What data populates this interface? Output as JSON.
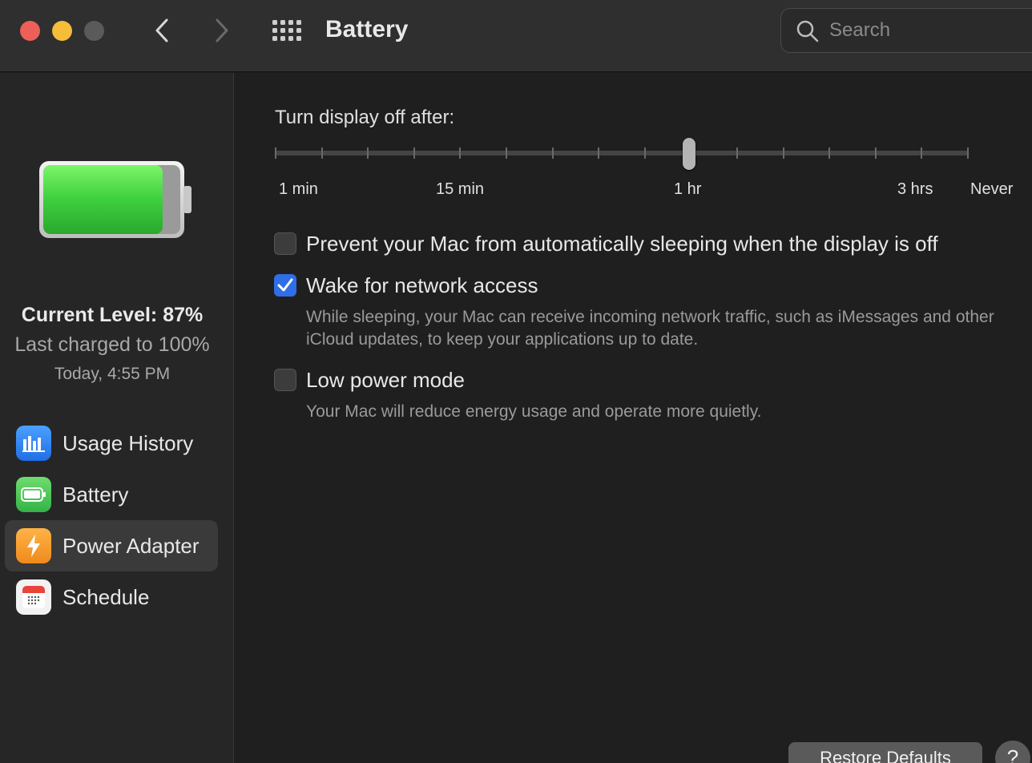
{
  "window": {
    "title": "Battery",
    "search_placeholder": "Search"
  },
  "icons": {
    "close": "close-icon",
    "minimize": "minimize-icon",
    "zoom": "zoom-icon",
    "back": "chevron-left-icon",
    "forward": "chevron-right-icon",
    "show_all": "grid-icon",
    "search": "search-icon"
  },
  "sidebar": {
    "current_level": "Current Level: 87%",
    "battery_fill_fraction": 0.87,
    "last_charged": "Last charged to 100%",
    "last_charged_time": "Today, 4:55 PM",
    "items": [
      {
        "label": "Usage History",
        "icon": "bar-chart-icon",
        "active": false
      },
      {
        "label": "Battery",
        "icon": "battery-icon",
        "active": false
      },
      {
        "label": "Power Adapter",
        "icon": "lightning-icon",
        "active": true
      },
      {
        "label": "Schedule",
        "icon": "calendar-icon",
        "active": false
      }
    ]
  },
  "main": {
    "slider": {
      "label": "Turn display off after:",
      "tick_labels": [
        "1 min",
        "15 min",
        "1 hr",
        "3 hrs",
        "Never"
      ],
      "selected": "1 hr"
    },
    "options": [
      {
        "label": "Prevent your Mac from automatically sleeping when the display is off",
        "checked": false,
        "description": ""
      },
      {
        "label": "Wake for network access",
        "checked": true,
        "description": "While sleeping, your Mac can receive incoming network traffic, such as iMessages and other iCloud updates, to keep your applications up to date."
      },
      {
        "label": "Low power mode",
        "checked": false,
        "description": "Your Mac will reduce energy usage and operate more quietly."
      }
    ],
    "restore_defaults": "Restore Defaults",
    "help": "?"
  },
  "colors": {
    "accent": "#2f6ee6",
    "battery_green": "#3ecf3e",
    "close": "#ee5f57",
    "minimize": "#f6bd3b"
  }
}
